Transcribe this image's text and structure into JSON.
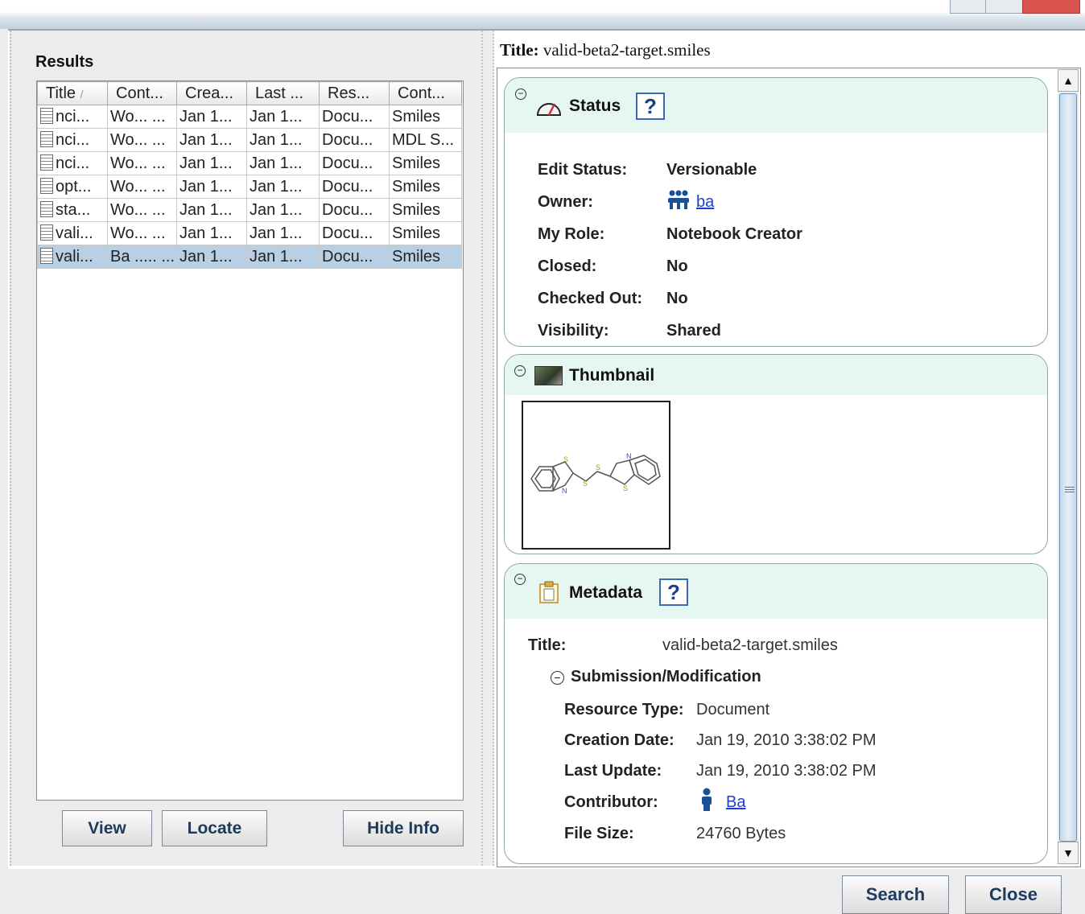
{
  "results": {
    "label": "Results",
    "columns": [
      "Title",
      "Cont...",
      "Crea...",
      "Last ...",
      "Res...",
      "Cont..."
    ],
    "sort_indicator": "/",
    "rows": [
      [
        "nci...",
        "Wo... ...",
        "Jan 1...",
        "Jan 1...",
        "Docu...",
        "Smiles"
      ],
      [
        "nci...",
        "Wo... ...",
        "Jan 1...",
        "Jan 1...",
        "Docu...",
        "MDL S..."
      ],
      [
        "nci...",
        "Wo... ...",
        "Jan 1...",
        "Jan 1...",
        "Docu...",
        "Smiles"
      ],
      [
        "opt...",
        "Wo... ...",
        "Jan 1...",
        "Jan 1...",
        "Docu...",
        "Smiles"
      ],
      [
        "sta...",
        "Wo... ...",
        "Jan 1...",
        "Jan 1...",
        "Docu...",
        "Smiles"
      ],
      [
        "vali...",
        "Wo... ...",
        "Jan 1...",
        "Jan 1...",
        "Docu...",
        "Smiles"
      ],
      [
        "vali...",
        "Ba ..... ...",
        "Jan 1...",
        "Jan 1...",
        "Docu...",
        "Smiles"
      ]
    ],
    "selected_row": 6,
    "buttons": {
      "view": "View",
      "locate": "Locate",
      "hide_info": "Hide Info"
    }
  },
  "detail": {
    "title_label": "Title:",
    "title_value": "valid-beta2-target.smiles",
    "status": {
      "heading": "Status",
      "help": "?",
      "labels": [
        "Edit Status:",
        "Owner:",
        "My Role:",
        "Closed:",
        "Checked Out:",
        "Visibility:"
      ],
      "values": [
        "Versionable",
        "ba",
        "Notebook Creator",
        "No",
        "No",
        "Shared"
      ]
    },
    "thumbnail": {
      "heading": "Thumbnail"
    },
    "metadata": {
      "heading": "Metadata",
      "help": "?",
      "title_label": "Title:",
      "title_value": "valid-beta2-target.smiles",
      "subsection": "Submission/Modification",
      "labels": [
        "Resource Type:",
        "Creation Date:",
        "Last Update:",
        "Contributor:",
        "File Size:"
      ],
      "values": [
        "Document",
        "Jan 19, 2010 3:38:02 PM",
        "Jan 19, 2010 3:38:02 PM",
        "Ba",
        "24760 Bytes"
      ]
    }
  },
  "footer": {
    "search": "Search",
    "close": "Close"
  },
  "colors": {
    "section_header": "#e6f7f2",
    "selection": "#b9cfe4",
    "link": "#1f3fcf",
    "help_border": "#3a6ab0"
  }
}
